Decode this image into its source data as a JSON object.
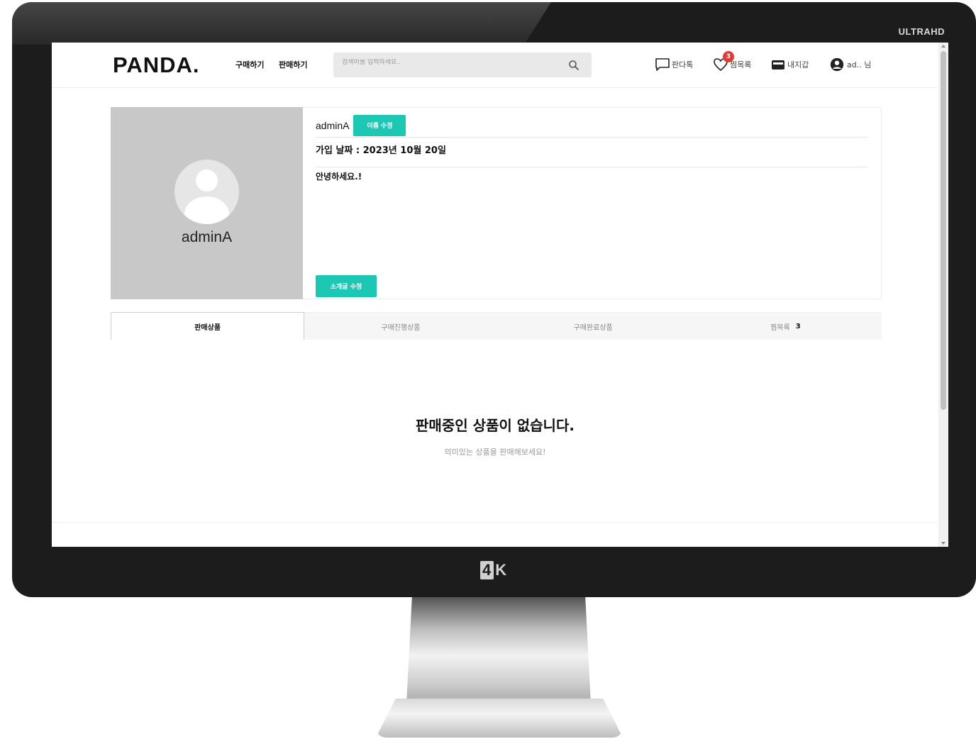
{
  "monitor": {
    "brand_ultra": "ULTRAHD",
    "brand_4k_a": "4",
    "brand_4k_b": "K"
  },
  "header": {
    "logo": "PANDA.",
    "nav": {
      "buy": "구매하기",
      "sell": "판매하기"
    },
    "search": {
      "placeholder": "검색어를 입력하세요..",
      "icon": "search-icon"
    },
    "chat_label": "판다톡",
    "wishlist_label": "찜목록",
    "wishlist_badge": "3",
    "wallet_label": "내지갑",
    "user_label": "ad.. 님"
  },
  "profile": {
    "name": "adminA",
    "avatar_icon": "user-avatar-icon",
    "info_name": "adminA",
    "edit_name_label": "이름 수정",
    "join_date": "가입 날짜 : 2023년 10월 20일",
    "intro": "안녕하세요.!",
    "edit_intro_label": "소개글 수정"
  },
  "tabs": [
    {
      "label": "판매상품",
      "active": true
    },
    {
      "label": "구매진행상품",
      "active": false
    },
    {
      "label": "구매완료상품",
      "active": false
    },
    {
      "label": "찜목록",
      "count": "3",
      "active": false
    }
  ],
  "empty_state": {
    "title": "판매중인 상품이 없습니다.",
    "subtitle": "의미있는 상품을 판매해보세요!"
  },
  "colors": {
    "accent": "#1cc7b4",
    "badge": "#e53935"
  }
}
